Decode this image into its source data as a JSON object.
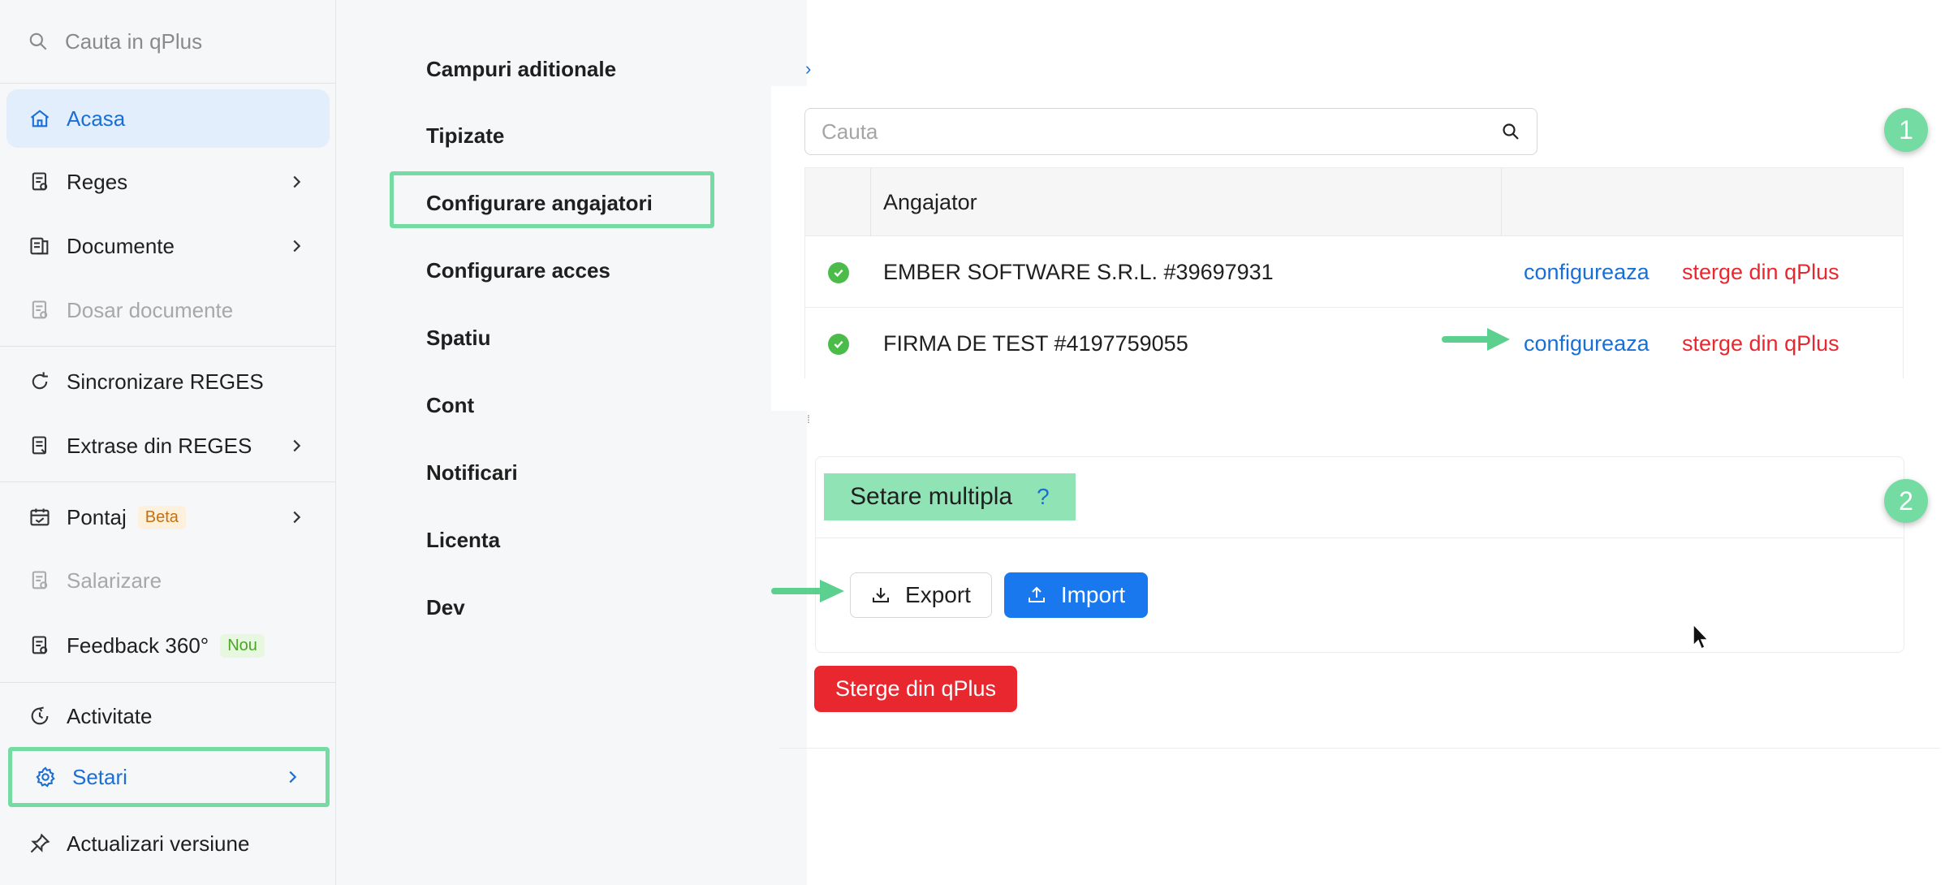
{
  "sidebar": {
    "search_placeholder": "Cauta in qPlus",
    "items": [
      {
        "label": "Acasa",
        "icon": "home-icon",
        "state": "active"
      },
      {
        "label": "Reges",
        "icon": "document-icon",
        "has_children": true
      },
      {
        "label": "Documente",
        "icon": "documents-icon",
        "has_children": true
      },
      {
        "label": "Dosar documente",
        "icon": "folder-doc-icon",
        "state": "disabled"
      },
      {
        "label": "Sincronizare REGES",
        "icon": "sync-icon"
      },
      {
        "label": "Extrase din REGES",
        "icon": "extract-icon",
        "has_children": true
      },
      {
        "label": "Pontaj",
        "icon": "calendar-icon",
        "badge": "Beta",
        "has_children": true
      },
      {
        "label": "Salarizare",
        "icon": "payroll-icon",
        "state": "disabled"
      },
      {
        "label": "Feedback 360°",
        "icon": "feedback-icon",
        "badge": "Nou"
      },
      {
        "label": "Activitate",
        "icon": "clock-icon"
      },
      {
        "label": "Setari",
        "icon": "gear-icon",
        "state": "selected",
        "has_children": true
      },
      {
        "label": "Actualizari versiune",
        "icon": "pin-icon"
      }
    ]
  },
  "submenu": {
    "items": [
      {
        "label": "Campuri aditionale"
      },
      {
        "label": "Tipizate"
      },
      {
        "label": "Configurare angajatori",
        "highlighted": true
      },
      {
        "label": "Configurare acces"
      },
      {
        "label": "Spatiu"
      },
      {
        "label": "Cont"
      },
      {
        "label": "Notificari"
      },
      {
        "label": "Licenta"
      },
      {
        "label": "Dev"
      }
    ]
  },
  "main": {
    "search_placeholder": "Cauta",
    "table": {
      "header": "Angajator",
      "rows": [
        {
          "name": "EMBER SOFTWARE S.R.L. #39697931",
          "configure": "configureaza",
          "delete": "sterge din qPlus",
          "status": "ok"
        },
        {
          "name": "FIRMA DE TEST #4197759055",
          "configure": "configureaza",
          "delete": "sterge din qPlus",
          "status": "ok"
        }
      ]
    },
    "setare": {
      "title": "Setare multipla",
      "help": "?",
      "export_label": "Export",
      "import_label": "Import"
    },
    "delete_button": "Sterge din qPlus",
    "steps": [
      "1",
      "2"
    ]
  },
  "colors": {
    "accent": "#1a6fd6",
    "highlight": "#74dba3",
    "danger": "#e8272f",
    "primary_button": "#1a78ef"
  }
}
